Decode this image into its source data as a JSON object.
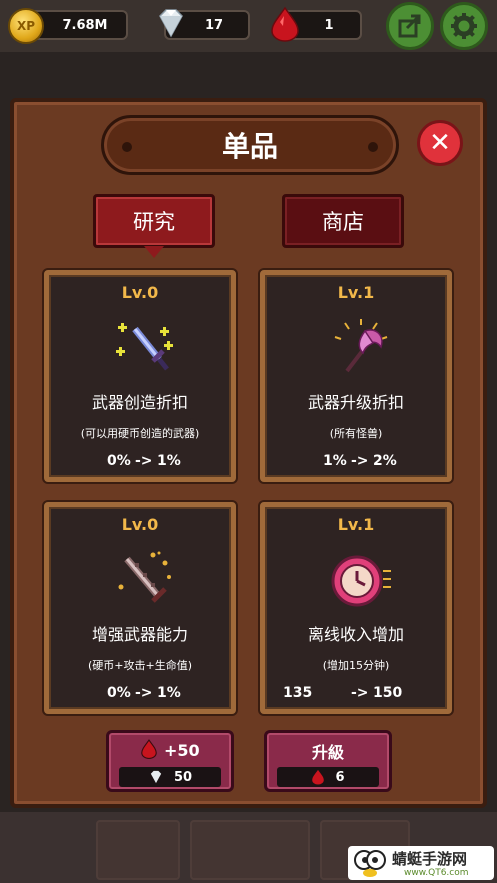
{
  "topbar": {
    "xp_badge": "XP",
    "xp_value": "7.68M",
    "diamond_value": "17",
    "ruby_value": "1",
    "icons": [
      "share-icon",
      "gear-icon"
    ]
  },
  "panel": {
    "title": "单品",
    "tabs": [
      {
        "label": "研究",
        "active": true
      },
      {
        "label": "商店",
        "active": false
      }
    ],
    "cards": [
      {
        "level": "Lv.0",
        "name": "武器创造折扣",
        "desc": "(可以用硬币创造的武器)",
        "from": "0%",
        "arrow": "->",
        "to": "1%",
        "icon": "sword-sparkle-icon"
      },
      {
        "level": "Lv.1",
        "name": "武器升级折扣",
        "desc": "(所有怪兽)",
        "from": "1%",
        "arrow": "->",
        "to": "2%",
        "icon": "axe-glow-icon"
      },
      {
        "level": "Lv.0",
        "name": "增强武器能力",
        "desc": "(硬币+攻击+生命值)",
        "from": "0%",
        "arrow": "->",
        "to": "1%",
        "icon": "serrated-sword-icon"
      },
      {
        "level": "Lv.1",
        "name": "离线收入增加",
        "desc": "(增加15分钟)",
        "from": "135",
        "arrow": "->",
        "to": "150",
        "icon": "clock-icon"
      }
    ],
    "buttons": [
      {
        "label": "+50",
        "cost": "50",
        "cost_icon": "diamond-icon",
        "top_icon": "ruby-icon"
      },
      {
        "label": "升級",
        "cost": "6",
        "cost_icon": "ruby-icon"
      }
    ]
  },
  "watermark": {
    "text": "蜻蜓手游网",
    "sub": "www.QT6.com"
  },
  "colors": {
    "accent_gold": "#f2b84a",
    "close_red": "#e0323b",
    "tab_red": "#8e1a1d",
    "button_magenta": "#8a2a4a"
  }
}
